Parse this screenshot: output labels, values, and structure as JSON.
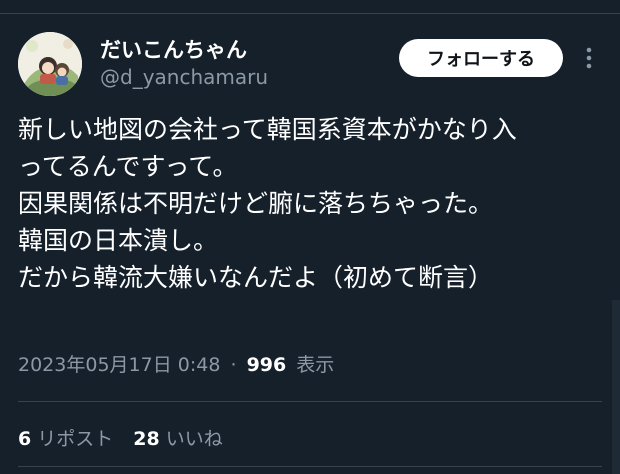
{
  "colors": {
    "background": "#15202b",
    "text_primary": "#ffffff",
    "text_secondary": "#8b98a5",
    "divider": "#38444d",
    "follow_button_bg": "#ffffff",
    "follow_button_text": "#0f1419"
  },
  "author": {
    "display_name": "だいこんちゃん",
    "handle": "@d_yanchamaru",
    "avatar_icon": "illustrated-avatar"
  },
  "actions": {
    "follow_label": "フォローする",
    "more_icon": "more-vertical-icon"
  },
  "tweet": {
    "lines": [
      "新しい地図の会社って韓国系資本がかなり入",
      "ってるんですって。",
      "因果関係は不明だけど腑に落ちちゃった。",
      "韓国の日本潰し。",
      "だから韓流大嫌いなんだよ（初めて断言）"
    ]
  },
  "meta": {
    "timestamp": "2023年05月17日 0:48",
    "separator": "·",
    "views_count": "996",
    "views_label": "表示"
  },
  "stats": {
    "reposts_count": "6",
    "reposts_label": "リポスト",
    "likes_count": "28",
    "likes_label": "いいね"
  }
}
